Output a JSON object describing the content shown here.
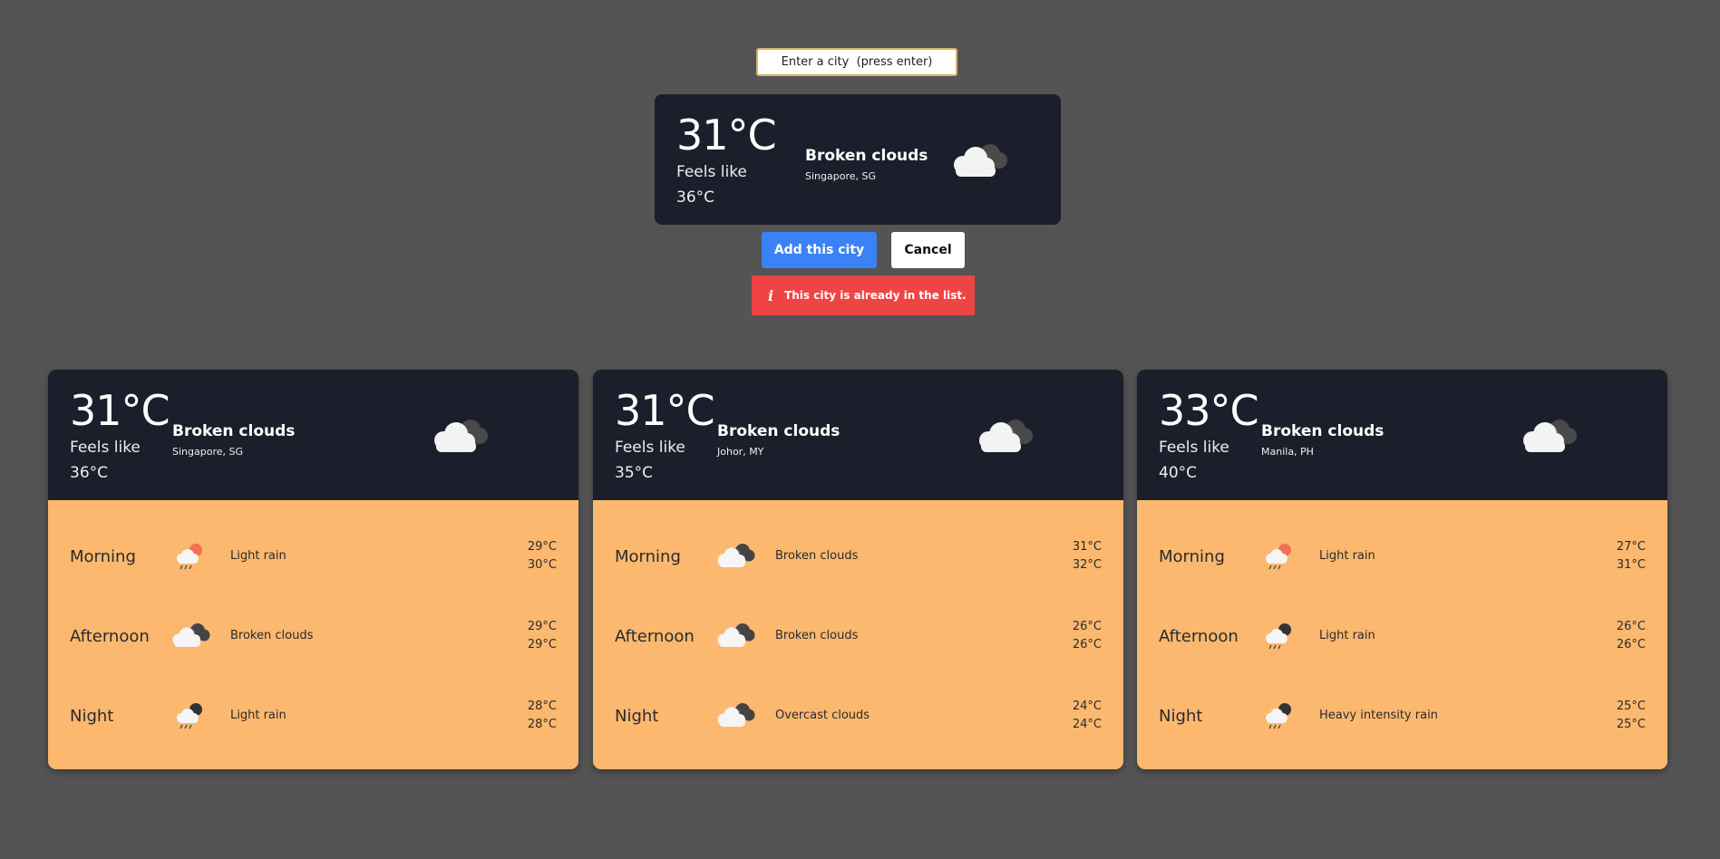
{
  "search": {
    "placeholder": "Enter a city  (press enter)"
  },
  "preview": {
    "temp": "31°C",
    "feels_label": "Feels like",
    "feels_value": "36°C",
    "description": "Broken clouds",
    "location": "Singapore, SG",
    "icon": "cloud-icon"
  },
  "actions": {
    "add_label": "Add this city",
    "cancel_label": "Cancel"
  },
  "alert": {
    "message": "This city is already in the list.",
    "icon": "info-icon"
  },
  "cities": [
    {
      "temp": "31°C",
      "feels_label": "Feels like",
      "feels_value": "36°C",
      "description": "Broken clouds",
      "location": "Singapore, SG",
      "forecast": [
        {
          "period": "Morning",
          "condition": "Light rain",
          "icon": "sun-rain-icon",
          "hi": "29°C",
          "lo": "30°C"
        },
        {
          "period": "Afternoon",
          "condition": "Broken clouds",
          "icon": "cloud-icon",
          "hi": "29°C",
          "lo": "29°C"
        },
        {
          "period": "Night",
          "condition": "Light rain",
          "icon": "moon-rain-icon",
          "hi": "28°C",
          "lo": "28°C"
        }
      ]
    },
    {
      "temp": "31°C",
      "feels_label": "Feels like",
      "feels_value": "35°C",
      "description": "Broken clouds",
      "location": "Johor, MY",
      "forecast": [
        {
          "period": "Morning",
          "condition": "Broken clouds",
          "icon": "cloud-icon",
          "hi": "31°C",
          "lo": "32°C"
        },
        {
          "period": "Afternoon",
          "condition": "Broken clouds",
          "icon": "cloud-icon",
          "hi": "26°C",
          "lo": "26°C"
        },
        {
          "period": "Night",
          "condition": "Overcast clouds",
          "icon": "cloud-icon",
          "hi": "24°C",
          "lo": "24°C"
        }
      ]
    },
    {
      "temp": "33°C",
      "feels_label": "Feels like",
      "feels_value": "40°C",
      "description": "Broken clouds",
      "location": "Manila, PH",
      "forecast": [
        {
          "period": "Morning",
          "condition": "Light rain",
          "icon": "sun-rain-icon",
          "hi": "27°C",
          "lo": "31°C"
        },
        {
          "period": "Afternoon",
          "condition": "Light rain",
          "icon": "moon-rain-icon",
          "hi": "26°C",
          "lo": "26°C"
        },
        {
          "period": "Night",
          "condition": "Heavy intensity rain",
          "icon": "moon-rain-icon",
          "hi": "25°C",
          "lo": "25°C"
        }
      ]
    }
  ],
  "colors": {
    "background": "#545454",
    "card_dark": "#1b1f2b",
    "card_orange": "#fdb870",
    "accent_blue": "#3b82f6",
    "alert_red": "#ef4444"
  }
}
